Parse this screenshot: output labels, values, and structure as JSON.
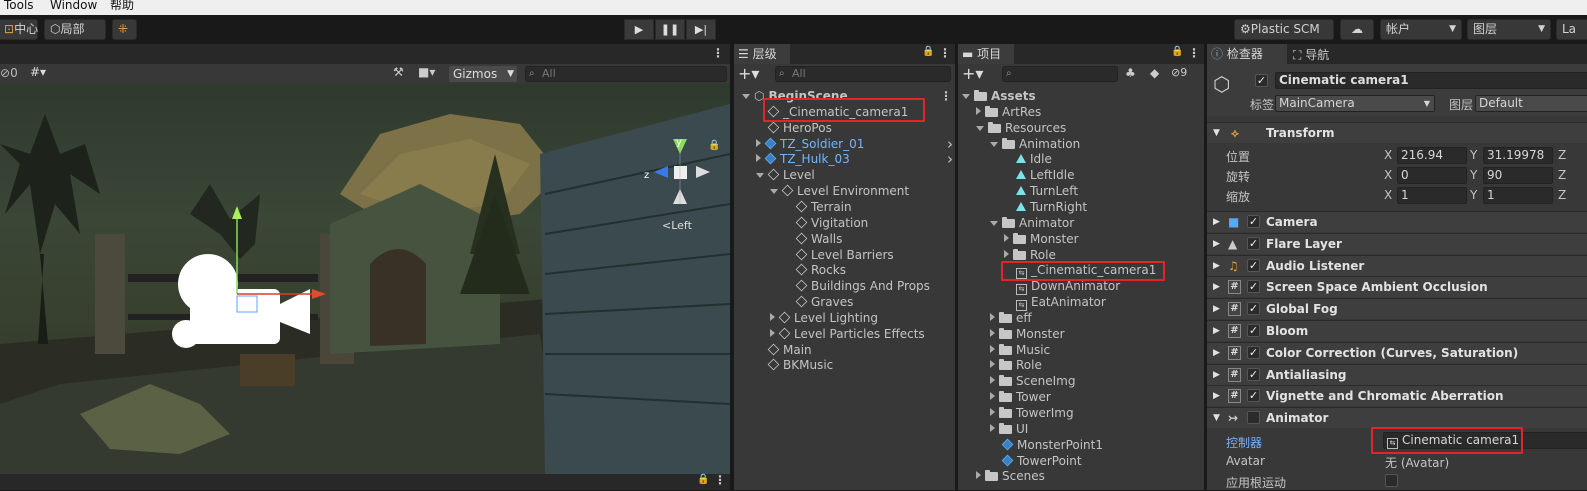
{
  "menu": {
    "tools": "Tools",
    "window": "Window",
    "help": "帮助"
  },
  "toolbar": {
    "center": "中心",
    "local": "局部",
    "plastic": "Plastic SCM",
    "account": "帐户",
    "layers": "图层",
    "layout_partial": "La"
  },
  "scene": {
    "hidden_count": "0",
    "gizmos": "Gizmos",
    "search_placeholder": "All",
    "view_label": "Left",
    "axis_y": "y",
    "axis_z": "z"
  },
  "hierarchy": {
    "tab": "层级",
    "search_placeholder": "All",
    "items": [
      {
        "label": "BeginScene",
        "indent": 0
      },
      {
        "label": "_Cinematic_camera1",
        "indent": 1
      },
      {
        "label": "HeroPos",
        "indent": 1
      },
      {
        "label": "TZ_Soldier_01",
        "indent": 1
      },
      {
        "label": "TZ_Hulk_03",
        "indent": 1
      },
      {
        "label": "Level",
        "indent": 1
      },
      {
        "label": "Level Environment",
        "indent": 2
      },
      {
        "label": "Terrain",
        "indent": 3
      },
      {
        "label": "Vigitation",
        "indent": 3
      },
      {
        "label": "Walls",
        "indent": 3
      },
      {
        "label": "Level Barriers",
        "indent": 3
      },
      {
        "label": "Rocks",
        "indent": 3
      },
      {
        "label": "Buildings And Props",
        "indent": 3
      },
      {
        "label": "Graves",
        "indent": 3
      },
      {
        "label": "Level Lighting",
        "indent": 2
      },
      {
        "label": "Level Particles Effects",
        "indent": 2
      },
      {
        "label": "Main",
        "indent": 1
      },
      {
        "label": "BKMusic",
        "indent": 1
      }
    ]
  },
  "project": {
    "tab": "项目",
    "hidden_count": "9",
    "items": [
      {
        "label": "Assets",
        "indent": 0
      },
      {
        "label": "ArtRes",
        "indent": 1
      },
      {
        "label": "Resources",
        "indent": 1
      },
      {
        "label": "Animation",
        "indent": 2
      },
      {
        "label": "Idle",
        "indent": 3
      },
      {
        "label": "LeftIdle",
        "indent": 3
      },
      {
        "label": "TurnLeft",
        "indent": 3
      },
      {
        "label": "TurnRight",
        "indent": 3
      },
      {
        "label": "Animator",
        "indent": 2
      },
      {
        "label": "Monster",
        "indent": 3
      },
      {
        "label": "Role",
        "indent": 3
      },
      {
        "label": "_Cinematic_camera1",
        "indent": 3
      },
      {
        "label": "DownAnimator",
        "indent": 3
      },
      {
        "label": "EatAnimator",
        "indent": 3
      },
      {
        "label": "eff",
        "indent": 2
      },
      {
        "label": "Monster",
        "indent": 2
      },
      {
        "label": "Music",
        "indent": 2
      },
      {
        "label": "Role",
        "indent": 2
      },
      {
        "label": "SceneImg",
        "indent": 2
      },
      {
        "label": "Tower",
        "indent": 2
      },
      {
        "label": "TowerImg",
        "indent": 2
      },
      {
        "label": "UI",
        "indent": 2
      },
      {
        "label": "MonsterPoint1",
        "indent": 2
      },
      {
        "label": "TowerPoint",
        "indent": 2
      },
      {
        "label": "Scenes",
        "indent": 1
      }
    ]
  },
  "inspector": {
    "tab": "检查器",
    "nav_tab": "导航",
    "object_name": "Cinematic camera1",
    "tag_label": "标签",
    "tag_value": "MainCamera",
    "layer_label": "图层",
    "layer_value": "Default",
    "transform": {
      "title": "Transform",
      "position_label": "位置",
      "rotation_label": "旋转",
      "scale_label": "缩放",
      "px": "216.94",
      "py": "31.19978",
      "rx": "0",
      "ry": "90",
      "sx": "1",
      "sy": "1",
      "x": "X",
      "y": "Y",
      "z": "Z"
    },
    "components": [
      "Camera",
      "Flare Layer",
      "Audio Listener",
      "Screen Space Ambient Occlusion",
      "Global Fog",
      "Bloom",
      "Color Correction (Curves, Saturation)",
      "Antialiasing",
      "Vignette and Chromatic Aberration",
      "Animator"
    ],
    "animator": {
      "controller_label": "控制器",
      "controller_value": "Cinematic camera1",
      "avatar_label": "Avatar",
      "avatar_value": "无 (Avatar)",
      "root_motion_label": "应用根运动"
    }
  }
}
